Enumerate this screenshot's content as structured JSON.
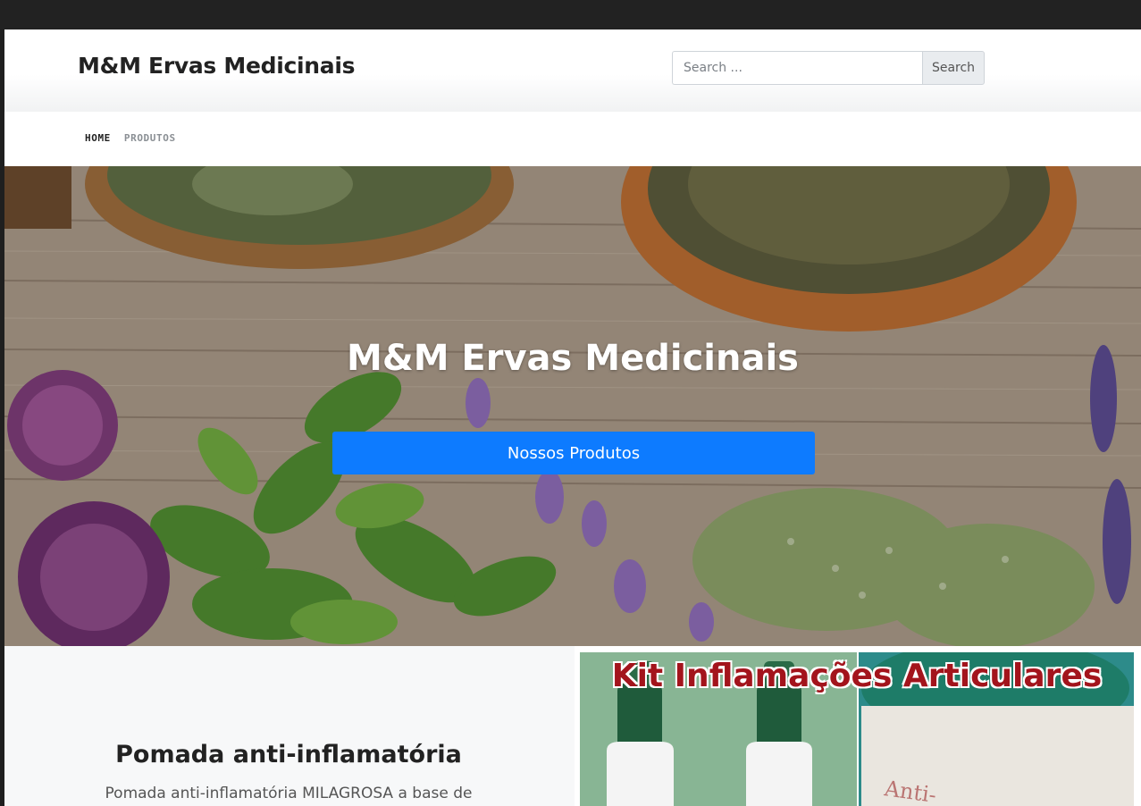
{
  "header": {
    "site_title": "M&M Ervas Medicinais",
    "search_placeholder": "Search ...",
    "search_button": "Search"
  },
  "nav": {
    "items": [
      {
        "label": "HOME",
        "active": true
      },
      {
        "label": "PRODUTOS",
        "active": false
      }
    ]
  },
  "hero": {
    "title": "M&M Ervas Medicinais",
    "button": "Nossos Produtos",
    "button_color": "#0d7bff"
  },
  "feature": {
    "title": "Pomada anti-inflamatória",
    "description": "Pomada anti-inflamatória MILAGROSA a base de",
    "image_caption": "Kit Inflamações Articulares",
    "image_caption_color": "#a3141c"
  }
}
